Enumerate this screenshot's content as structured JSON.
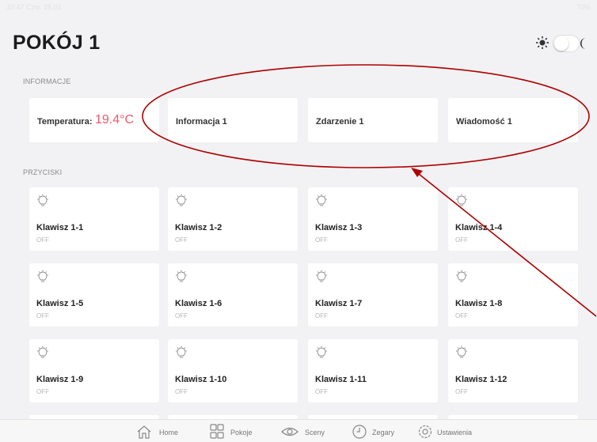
{
  "status_bar": {
    "left": "10:47  Czw. 28.01",
    "right": "70%"
  },
  "title": "POKÓJ 1",
  "sections": {
    "info": "INFORMACJE",
    "buttons": "PRZYCISKI"
  },
  "info_cards": {
    "temperature_label": "Temperatura:",
    "temperature_value": "19.4°C",
    "items": [
      "Informacja 1",
      "Zdarzenie 1",
      "Wiadomość 1"
    ]
  },
  "buttons": [
    {
      "label": "Klawisz 1-1",
      "state": "OFF"
    },
    {
      "label": "Klawisz 1-2",
      "state": "OFF"
    },
    {
      "label": "Klawisz 1-3",
      "state": "OFF"
    },
    {
      "label": "Klawisz 1-4",
      "state": "OFF"
    },
    {
      "label": "Klawisz 1-5",
      "state": "OFF"
    },
    {
      "label": "Klawisz 1-6",
      "state": "OFF"
    },
    {
      "label": "Klawisz 1-7",
      "state": "OFF"
    },
    {
      "label": "Klawisz 1-8",
      "state": "OFF"
    },
    {
      "label": "Klawisz 1-9",
      "state": "OFF"
    },
    {
      "label": "Klawisz 1-10",
      "state": "OFF"
    },
    {
      "label": "Klawisz 1-11",
      "state": "OFF"
    },
    {
      "label": "Klawisz 1-12",
      "state": "OFF"
    }
  ],
  "nav": {
    "home": "Home",
    "rooms": "Pokoje",
    "scenes": "Sceny",
    "clocks": "Zegary",
    "settings": "Ustawienia"
  },
  "colors": {
    "accent": "#f05868",
    "annotation": "#b00000",
    "background": "#f2f2f4"
  },
  "icons": {
    "theme": [
      "sun-icon",
      "moon-icon"
    ],
    "buttons": "bulb-icon",
    "nav": [
      "home-icon",
      "grid-icon",
      "eye-icon",
      "clock-icon",
      "gear-icon"
    ]
  }
}
